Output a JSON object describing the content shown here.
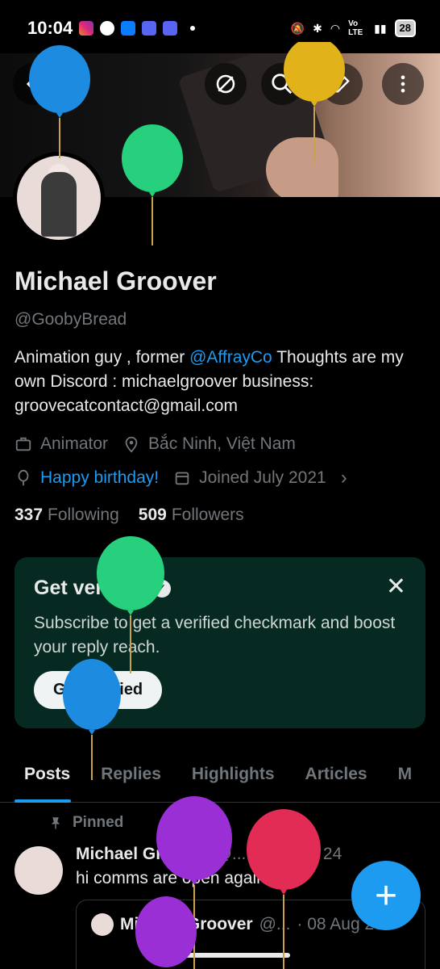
{
  "status_bar": {
    "time": "10:04",
    "battery": "28",
    "network": "Vo LTE"
  },
  "header": {
    "back_icon": "arrow-left-icon",
    "icons": [
      "no-bell-icon",
      "search-icon",
      "edit-icon",
      "more-vertical-icon"
    ]
  },
  "profile": {
    "name": "Michael Groover",
    "handle": "@GoobyBread",
    "bio_prefix": "Animation guy , former ",
    "bio_link": "@AffrayCo",
    "bio_suffix": " Thoughts are my own Discord : michaelgroover business: groovecatcontact@gmail.com",
    "occupation": "Animator",
    "location": "Bắc Ninh, Việt Nam",
    "birthday": "Happy birthday!",
    "joined": "Joined July 2021",
    "following_count": "337",
    "following_label": "Following",
    "followers_count": "509",
    "followers_label": "Followers"
  },
  "verified_card": {
    "title": "Get verified",
    "body": "Subscribe to get a verified checkmark and boost your reply reach.",
    "button": "Get Verified",
    "close": "✕"
  },
  "tabs": [
    "Posts",
    "Replies",
    "Highlights",
    "Articles",
    "M"
  ],
  "active_tab": "Posts",
  "pinned_post": {
    "pinned_label": "Pinned",
    "author": "Michael Groover",
    "handle": "@...",
    "date": "· 14 May 24",
    "text": "hi comms are open again!!!",
    "quote": {
      "author": "Michael Groover",
      "handle": "@...",
      "date": "· 08 Aug 23"
    }
  },
  "fab": {
    "label": "+"
  },
  "colors": {
    "accent": "#1d9bf0",
    "card_bg": "#062a22",
    "muted": "#71767b"
  }
}
